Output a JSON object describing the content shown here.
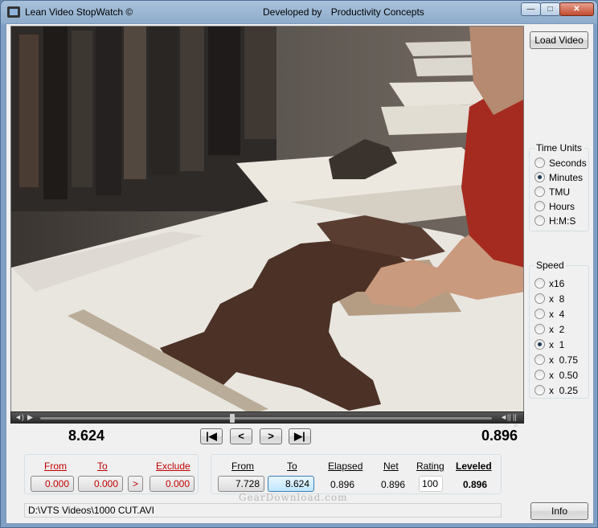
{
  "window": {
    "title": "Lean Video StopWatch ©",
    "developed_by": "Developed by",
    "company": "Productivity Concepts",
    "minimize_symbol": "—",
    "maximize_symbol": "□",
    "close_symbol": "✕"
  },
  "buttons": {
    "load_video": "Load Video",
    "info": "Info",
    "first_frame": "|◀",
    "prev": "<",
    "next": ">",
    "last_frame": "▶|",
    "exclude_arrow": ">"
  },
  "time_units": {
    "title": "Time Units",
    "options": [
      "Seconds",
      "Minutes",
      "TMU",
      "Hours",
      "H:M:S"
    ],
    "selected": "Minutes"
  },
  "speed": {
    "title": "Speed",
    "options": [
      "x16",
      "x  8",
      "x  4",
      "x  2",
      "x  1",
      "x  0.75",
      "x  0.50",
      "x  0.25"
    ],
    "selected": "x  1"
  },
  "readouts": {
    "current": "8.624",
    "total": "0.896"
  },
  "exclude_panel": {
    "from_label": "From",
    "to_label": "To",
    "exclude_label": "Exclude",
    "from_value": "0.000",
    "to_value": "0.000",
    "exclude_value": "0.000"
  },
  "measure_panel": {
    "from_label": "From",
    "to_label": "To",
    "elapsed_label": "Elapsed",
    "net_label": "Net",
    "rating_label": "Rating",
    "leveled_label": "Leveled",
    "from_value": "7.728",
    "to_value": "8.624",
    "elapsed_value": "0.896",
    "net_value": "0.896",
    "rating_value": "100",
    "leveled_value": "0.896"
  },
  "status": {
    "file_path": "D:\\VTS Videos\\1000 CUT.AVI"
  },
  "media": {
    "position_fraction": 0.48,
    "volume_icon": "speaker-icon",
    "play_icon": "play-icon"
  },
  "watermark": "GearDownload.com",
  "colors": {
    "accent_red": "#c00000",
    "title_bar": "#8eaccb"
  }
}
